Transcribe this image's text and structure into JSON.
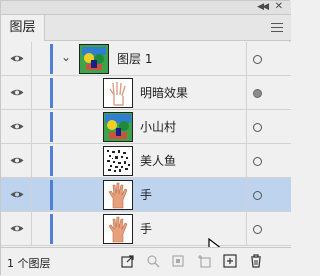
{
  "panel": {
    "titlebar": {
      "collapse_icon": "double-chevron-left",
      "close_icon": "close"
    },
    "tab": {
      "label": "图层"
    },
    "menu_icon": "hamburger-menu"
  },
  "layers": [
    {
      "name": "图层 1",
      "type": "group",
      "expanded": true,
      "visible": true,
      "target_filled": false,
      "selected": false
    },
    {
      "name": "明暗效果",
      "type": "hand-sketch",
      "visible": true,
      "target_filled": true,
      "selected": false
    },
    {
      "name": "小山村",
      "type": "village-picture",
      "visible": true,
      "target_filled": false,
      "selected": false
    },
    {
      "name": "美人鱼",
      "type": "noise-picture",
      "visible": true,
      "target_filled": false,
      "selected": false
    },
    {
      "name": "手",
      "type": "hand-photo",
      "visible": true,
      "target_filled": false,
      "selected": true
    },
    {
      "name": "手",
      "type": "hand-photo",
      "visible": true,
      "target_filled": false,
      "selected": false
    }
  ],
  "footer": {
    "layer_count": "1 个图层",
    "icons": [
      "export-icon",
      "search-icon",
      "clip-mask-icon",
      "sublayer-icon",
      "new-layer-icon",
      "trash-icon"
    ]
  },
  "colors": {
    "selection": "#bdd3ee",
    "layer_color": "#4f7fd6"
  }
}
